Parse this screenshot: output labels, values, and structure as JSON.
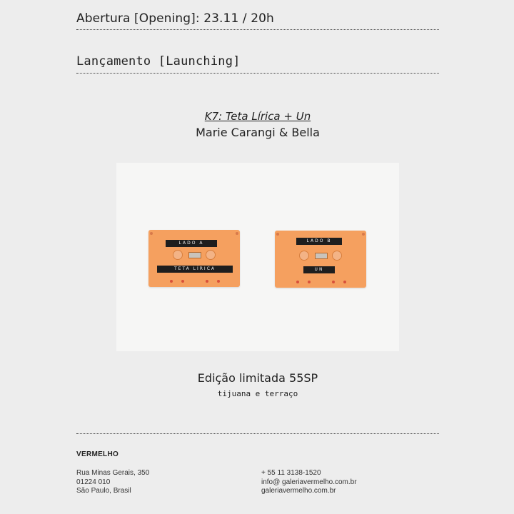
{
  "header": {
    "opening": "Abertura [Opening]: 23.11 / 20h",
    "launching": "Lançamento [Launching]"
  },
  "release": {
    "title": "K7: Teta Lírica + Un",
    "artists": "Marie Carangi & Bella"
  },
  "image": {
    "cassette_a": {
      "top_label": "LADO A",
      "bottom_label": "TETA LÍRICA"
    },
    "cassette_b": {
      "top_label": "LADO B",
      "bottom_label": "UN"
    },
    "cassette_color": "#f5a05f"
  },
  "edition": {
    "text": "Edição limitada 55SP",
    "venue": "tijuana e terraço"
  },
  "footer": {
    "name": "VERMELHO",
    "address": {
      "line1": "Rua Minas Gerais, 350",
      "line2": "01224 010",
      "line3": "São Paulo, Brasil"
    },
    "contact": {
      "phone": "+ 55 11 3138-1520",
      "email": "info@ galeriavermelho.com.br",
      "website": "galeriavermelho.com.br"
    }
  }
}
